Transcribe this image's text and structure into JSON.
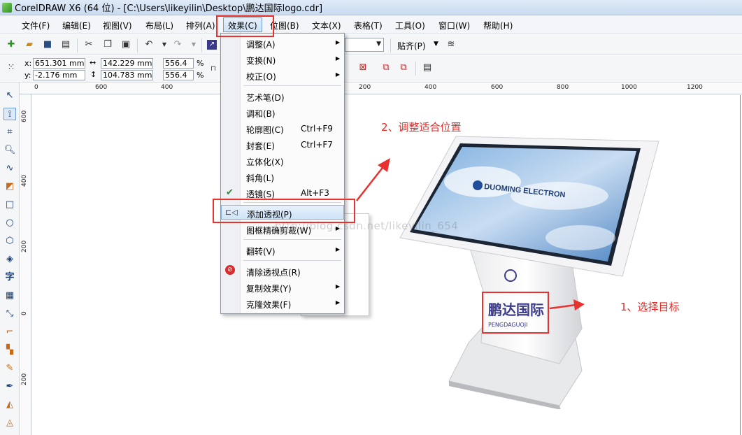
{
  "title_bar": {
    "text": "CorelDRAW X6 (64 位) - [C:\\Users\\likeyilin\\Desktop\\鹏达国际logo.cdr]"
  },
  "menu_bar": [
    {
      "label": "文件(F)"
    },
    {
      "label": "编辑(E)"
    },
    {
      "label": "视图(V)"
    },
    {
      "label": "布局(L)"
    },
    {
      "label": "排列(A)"
    },
    {
      "label": "效果(C)"
    },
    {
      "label": "位图(B)"
    },
    {
      "label": "文本(X)"
    },
    {
      "label": "表格(T)"
    },
    {
      "label": "工具(O)"
    },
    {
      "label": "窗口(W)"
    },
    {
      "label": "帮助(H)"
    }
  ],
  "toolbar": {
    "snap_label": "贴齐(P)"
  },
  "property_bar": {
    "x_label": "x:",
    "x_value": "651.301 mm",
    "y_label": "y:",
    "y_value": "-2.176 mm",
    "width_value": "142.229 mm",
    "height_value": "104.783 mm",
    "scale_x": "556.4",
    "scale_y": "556.4",
    "percent": "%"
  },
  "ruler_top": [
    "0",
    "600",
    "400",
    "200",
    "400",
    "600",
    "800",
    "1000",
    "1200"
  ],
  "ruler_left": [
    "600",
    "400",
    "200",
    "0",
    "200"
  ],
  "effects_menu": [
    {
      "label": "调整(A)",
      "shortcut": "",
      "submenu": true
    },
    {
      "label": "变换(N)",
      "shortcut": "",
      "submenu": true
    },
    {
      "label": "校正(O)",
      "shortcut": "",
      "submenu": true
    },
    {
      "label": "艺术笔(D)",
      "shortcut": "",
      "submenu": false
    },
    {
      "label": "调和(B)",
      "shortcut": "",
      "submenu": false
    },
    {
      "label": "轮廓图(C)",
      "shortcut": "Ctrl+F9",
      "submenu": false
    },
    {
      "label": "封套(E)",
      "shortcut": "Ctrl+F7",
      "submenu": false
    },
    {
      "label": "立体化(X)",
      "shortcut": "",
      "submenu": false
    },
    {
      "label": "斜角(L)",
      "shortcut": "",
      "submenu": false
    },
    {
      "label": "透镜(S)",
      "shortcut": "Alt+F3",
      "submenu": false
    },
    {
      "label": "添加透视(P)",
      "shortcut": "",
      "submenu": false
    },
    {
      "label": "图框精确剪裁(W)",
      "shortcut": "",
      "submenu": true
    },
    {
      "label": "翻转(V)",
      "shortcut": "",
      "submenu": true
    },
    {
      "label": "清除透视点(R)",
      "shortcut": "",
      "submenu": false
    },
    {
      "label": "复制效果(Y)",
      "shortcut": "",
      "submenu": true
    },
    {
      "label": "克隆效果(F)",
      "shortcut": "",
      "submenu": true
    }
  ],
  "annotations": {
    "step1": "1、选择目标",
    "step2": "2、调整适合位置"
  },
  "watermark": "http://blog.csdn.net/likeyilin_654",
  "kiosk": {
    "screen_brand": "DUOMING ELECTRON",
    "logo_text": "鹏达国际",
    "logo_subtext": "PENGDAGUOJI"
  },
  "colors": {
    "annotation_red": "#e8322f",
    "menu_highlight": "#cfe3f8"
  }
}
